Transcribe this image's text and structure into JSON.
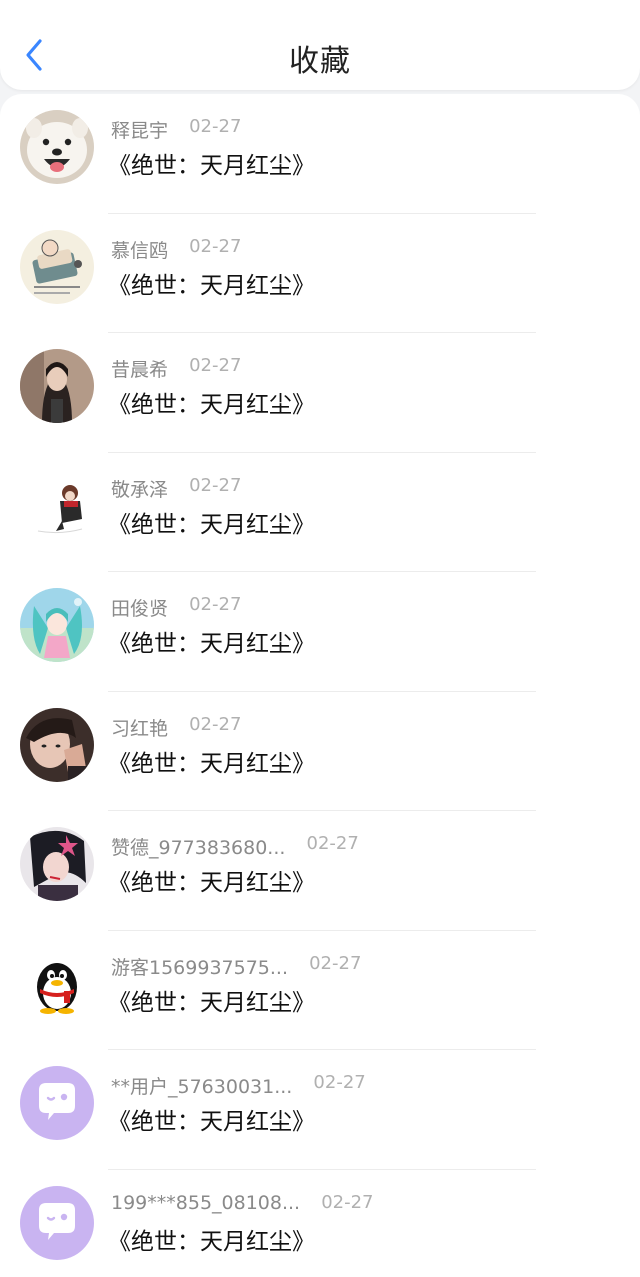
{
  "header": {
    "title": "收藏",
    "back_icon": "chevron-left-icon",
    "accent": "#3a86ff"
  },
  "favorites": [
    {
      "name": "释昆宇",
      "date": "02-27",
      "book": "《绝世：天月红尘》",
      "avatar": "samoyed-dog-avatar"
    },
    {
      "name": "慕信鸥",
      "date": "02-27",
      "book": "《绝世：天月红尘》",
      "avatar": "cartoon-baby-avatar"
    },
    {
      "name": "昔晨希",
      "date": "02-27",
      "book": "《绝世：天月红尘》",
      "avatar": "girl-photo-avatar"
    },
    {
      "name": "敬承泽",
      "date": "02-27",
      "book": "《绝世：天月红尘》",
      "avatar": "anime-character-avatar"
    },
    {
      "name": "田俊贤",
      "date": "02-27",
      "book": "《绝世：天月红尘》",
      "avatar": "anime-idol-avatar"
    },
    {
      "name": "习红艳",
      "date": "02-27",
      "book": "《绝世：天月红尘》",
      "avatar": "girl-selfie-avatar"
    },
    {
      "name": "赞德_977383680...",
      "date": "02-27",
      "book": "《绝世：天月红尘》",
      "avatar": "anime-girl-avatar"
    },
    {
      "name": "游客1569937575...",
      "date": "02-27",
      "book": "《绝世：天月红尘》",
      "avatar": "qq-penguin-avatar"
    },
    {
      "name": "**用户_57630031...",
      "date": "02-27",
      "book": "《绝世：天月红尘》",
      "avatar": "chat-bubble-avatar"
    },
    {
      "name": "199***855_08108...",
      "date": "02-27",
      "book": "《绝世：天月红尘》",
      "avatar": "chat-bubble-avatar"
    }
  ]
}
